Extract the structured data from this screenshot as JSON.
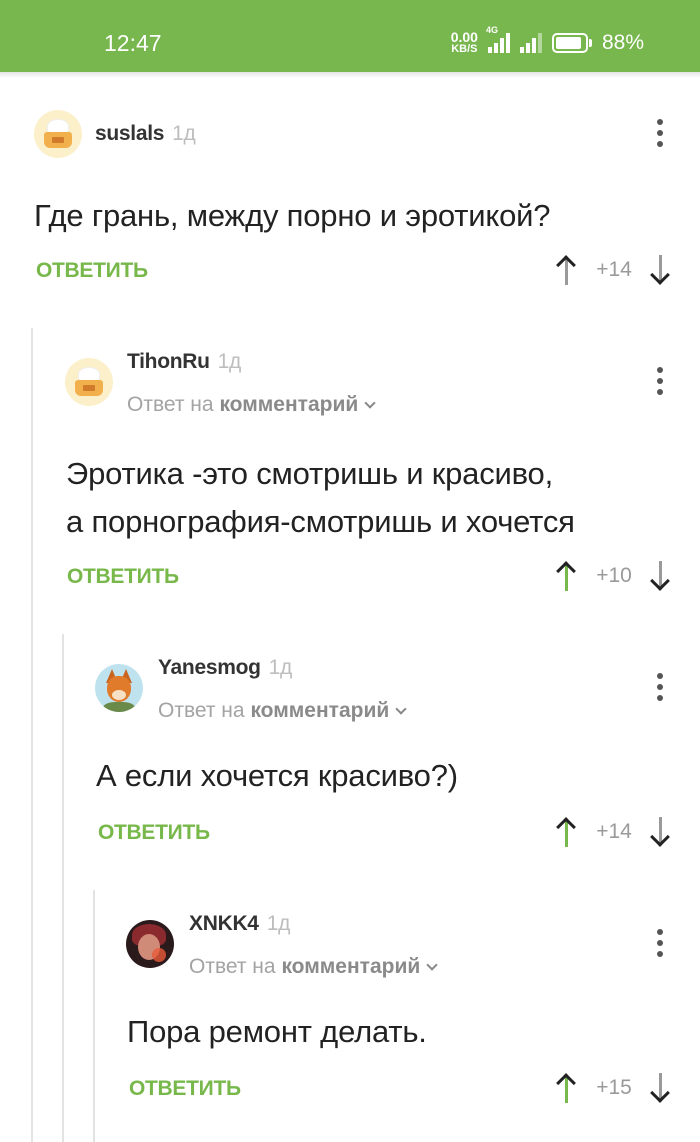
{
  "status_bar": {
    "time": "12:47",
    "net_speed_value": "0.00",
    "net_speed_unit": "KB/S",
    "network_type": "4G",
    "battery": "88%"
  },
  "colors": {
    "accent": "#78b84b",
    "status_bar": "#77b74d"
  },
  "comments": [
    {
      "author": "suslals",
      "time_ago": "1д",
      "text": "Где грань, между порно и эротикой?",
      "reply_label": "ОТВЕТИТЬ",
      "score": "+14",
      "avatar_icon": "cake-avatar-icon",
      "upvoted": false
    },
    {
      "author": "TihonRu",
      "time_ago": "1д",
      "reply_prefix": "Ответ на",
      "reply_target": "комментарий",
      "text_line1": "Эротика -это смотришь и красиво,",
      "text_line2": "а порнография-смотришь и хочется",
      "reply_label": "ОТВЕТИТЬ",
      "score": "+10",
      "avatar_icon": "cake-avatar-icon",
      "upvoted": true
    },
    {
      "author": "Yanesmog",
      "time_ago": "1д",
      "reply_prefix": "Ответ на",
      "reply_target": "комментарий",
      "text": "А если хочется красиво?)",
      "reply_label": "ОТВЕТИТЬ",
      "score": "+14",
      "avatar_icon": "fox-avatar-icon",
      "upvoted": true
    },
    {
      "author": "XNKK4",
      "time_ago": "1д",
      "reply_prefix": "Ответ на",
      "reply_target": "комментарий",
      "text": "Пора ремонт делать.",
      "reply_label": "ОТВЕТИТЬ",
      "score": "+15",
      "avatar_icon": "character-avatar-icon",
      "upvoted": true
    }
  ]
}
